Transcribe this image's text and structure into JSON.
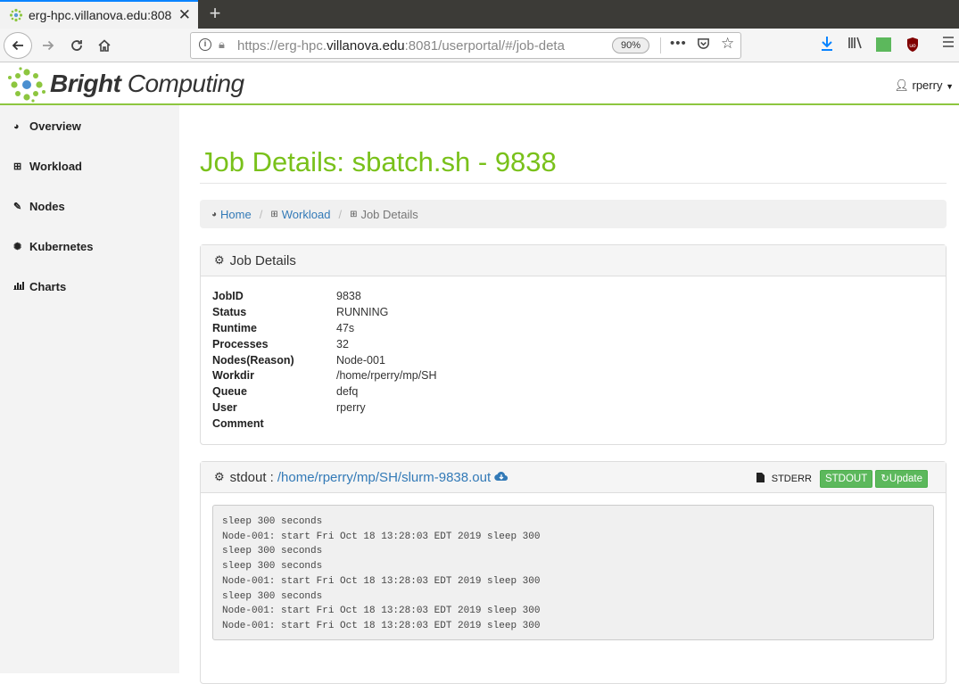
{
  "browser": {
    "tab_title": "erg-hpc.villanova.edu:808",
    "close_glyph": "✕",
    "newtab_glyph": "+",
    "url_prefix": "https://erg-hpc.",
    "url_domain": "villanova.edu",
    "url_suffix": ":8081/userportal/#/job-deta",
    "zoom": "90%"
  },
  "header": {
    "brand_bold": "Bright",
    "brand_rest": " Computing",
    "user": "rperry"
  },
  "sidebar": {
    "items": [
      {
        "label": "Overview",
        "icon": "dashboard-icon"
      },
      {
        "label": "Workload",
        "icon": "table-icon"
      },
      {
        "label": "Nodes",
        "icon": "edit-icon"
      },
      {
        "label": "Kubernetes",
        "icon": "kubernetes-icon"
      },
      {
        "label": "Charts",
        "icon": "bar-chart-icon"
      }
    ]
  },
  "page": {
    "title": "Job Details: sbatch.sh - 9838",
    "breadcrumb": {
      "home": "Home",
      "workload": "Workload",
      "current": "Job Details"
    }
  },
  "job_panel": {
    "title": "Job Details",
    "fields": [
      {
        "k": "JobID",
        "v": "9838"
      },
      {
        "k": "Status",
        "v": "RUNNING"
      },
      {
        "k": "Runtime",
        "v": "47s"
      },
      {
        "k": "Processes",
        "v": "32"
      },
      {
        "k": "Nodes(Reason)",
        "v": "Node-001"
      },
      {
        "k": "Workdir",
        "v": "/home/rperry/mp/SH"
      },
      {
        "k": "Queue",
        "v": "defq"
      },
      {
        "k": "User",
        "v": "rperry"
      },
      {
        "k": "Comment",
        "v": ""
      }
    ]
  },
  "stdout_panel": {
    "label": "stdout :",
    "path": "/home/rperry/mp/SH/slurm-9838.out",
    "stderr_label": "STDERR",
    "stdout_button": "STDOUT",
    "update_button": "Update",
    "output": "sleep 300 seconds\nNode-001: start Fri Oct 18 13:28:03 EDT 2019 sleep 300\nsleep 300 seconds\nsleep 300 seconds\nNode-001: start Fri Oct 18 13:28:03 EDT 2019 sleep 300\nsleep 300 seconds\nNode-001: start Fri Oct 18 13:28:03 EDT 2019 sleep 300\nNode-001: start Fri Oct 18 13:28:03 EDT 2019 sleep 300"
  },
  "colors": {
    "accent": "#79c11a",
    "link": "#337ab7",
    "button": "#5cb85c"
  }
}
